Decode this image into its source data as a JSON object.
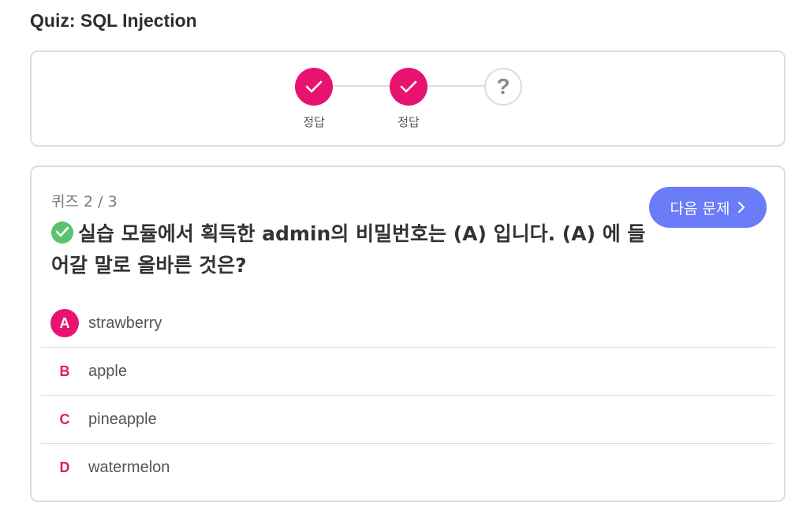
{
  "page": {
    "title": "Quiz: SQL Injection"
  },
  "progress": {
    "steps": [
      {
        "state": "done",
        "label": "정답"
      },
      {
        "state": "done",
        "label": "정답"
      },
      {
        "state": "pending",
        "symbol": "?"
      }
    ]
  },
  "quiz": {
    "counter": "퀴즈 2 / 3",
    "question": "실습 모듈에서 획득한 admin의 비밀번호는 (A) 입니다. (A) 에 들어갈 말로 올바른 것은?",
    "next_label": "다음 문제",
    "options": [
      {
        "letter": "A",
        "text": "strawberry",
        "selected": true
      },
      {
        "letter": "B",
        "text": "apple"
      },
      {
        "letter": "C",
        "text": "pineapple"
      },
      {
        "letter": "D",
        "text": "watermelon"
      }
    ]
  },
  "colors": {
    "accent": "#e8136f",
    "correct": "#5bc36d",
    "button": "#6a7cf8",
    "border": "#dcdde3"
  }
}
